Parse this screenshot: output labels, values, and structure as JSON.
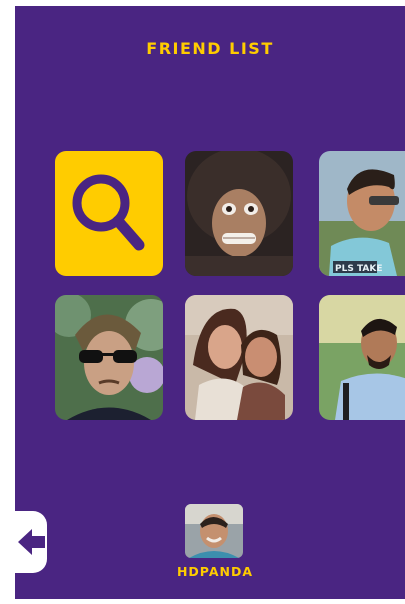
{
  "header": {
    "title": "FRIEND LIST"
  },
  "search_tile": {
    "icon": "search-icon",
    "color": "#ffcc00"
  },
  "friends": [
    {
      "label": "friend-1"
    },
    {
      "label": "friend-2"
    },
    {
      "label": "friend-3"
    },
    {
      "label": "friend-4"
    },
    {
      "label": "friend-5"
    }
  ],
  "current_user": {
    "username": "HDPANDA"
  },
  "nav": {
    "back_icon": "arrow-left-icon"
  },
  "colors": {
    "background": "#4a2582",
    "accent": "#ffcc00",
    "white": "#ffffff"
  }
}
